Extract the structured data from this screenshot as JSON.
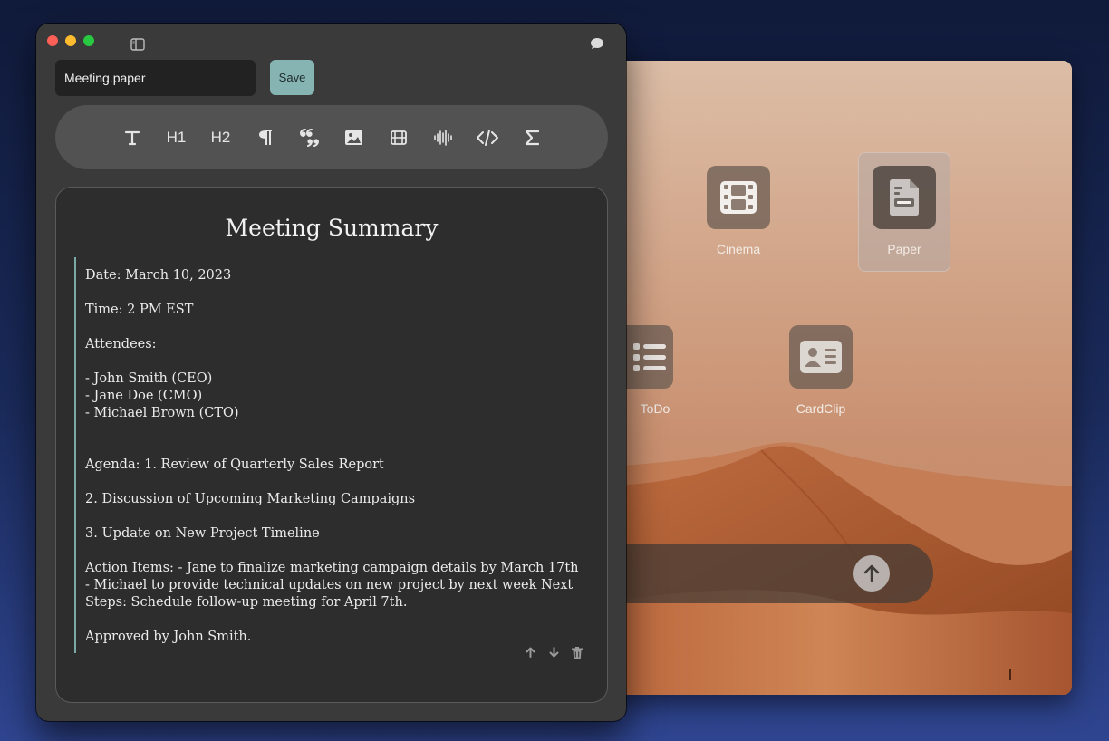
{
  "back_window": {
    "apps": [
      {
        "name": "Cinema"
      },
      {
        "name": "Paper",
        "selected": true
      },
      {
        "name": "ToDo"
      },
      {
        "name": "CardClip"
      }
    ]
  },
  "editor": {
    "filename": "Meeting.paper",
    "save_label": "Save",
    "toolbar": {
      "tools": [
        "text-icon",
        "H1",
        "H2",
        "paragraph-icon",
        "quote-icon",
        "image-icon",
        "video-icon",
        "audio-icon",
        "code-icon",
        "math-icon"
      ],
      "h1_label": "H1",
      "h2_label": "H2"
    },
    "document": {
      "title": "Meeting Summary",
      "date": "Date: March 10, 2023",
      "time": "Time: 2 PM EST",
      "attendees_heading": "Attendees:",
      "attendees": [
        "- John Smith (CEO)",
        "- Jane Doe (CMO)",
        "- Michael Brown (CTO)"
      ],
      "agenda_1": "Agenda: 1. Review of Quarterly Sales Report",
      "agenda_2": "2. Discussion of Upcoming Marketing Campaigns",
      "agenda_3": "3. Update on New Project Timeline",
      "action_items": "Action Items: - Jane to finalize marketing campaign details by March 17th - Michael to provide technical updates on new project by next week Next Steps: Schedule follow-up meeting for April 7th.",
      "approval": "Approved by John Smith."
    }
  },
  "colors": {
    "accent": "#86b4b3",
    "block_border": "#7aa9a6",
    "window_bg": "#3a3a3a",
    "traffic_red": "#fe5f57",
    "traffic_yellow": "#febc2e",
    "traffic_green": "#28c840"
  }
}
